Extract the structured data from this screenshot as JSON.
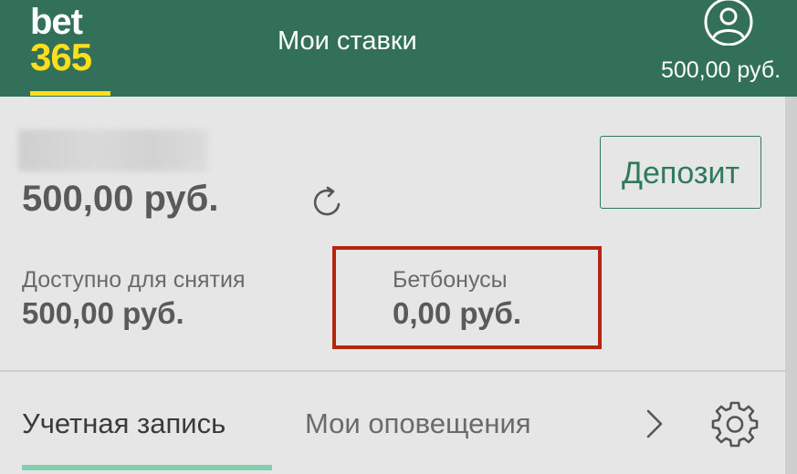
{
  "header": {
    "logo": {
      "top": "bet",
      "bottom": "365"
    },
    "nav_title": "Мои ставки",
    "balance": "500,00 руб.",
    "icons": {
      "user": "user-account-icon"
    }
  },
  "account": {
    "balance": "500,00 руб.",
    "deposit_label": "Депозит",
    "withdrawable": {
      "label": "Доступно для снятия",
      "value": "500,00 руб."
    },
    "betbonus": {
      "label": "Бетбонусы",
      "value": "0,00 руб."
    },
    "icons": {
      "refresh": "refresh-icon"
    }
  },
  "tabs": {
    "account": "Учетная запись",
    "alerts": "Мои оповещения",
    "icons": {
      "next": "chevron-right-icon",
      "settings": "gear-icon"
    }
  },
  "colors": {
    "header_bg": "#33705a",
    "logo_yellow": "#ffdf1b",
    "accent_green": "#2f7a5a",
    "highlight_red": "#b5260f",
    "tab_underline": "#7fd0b1"
  }
}
